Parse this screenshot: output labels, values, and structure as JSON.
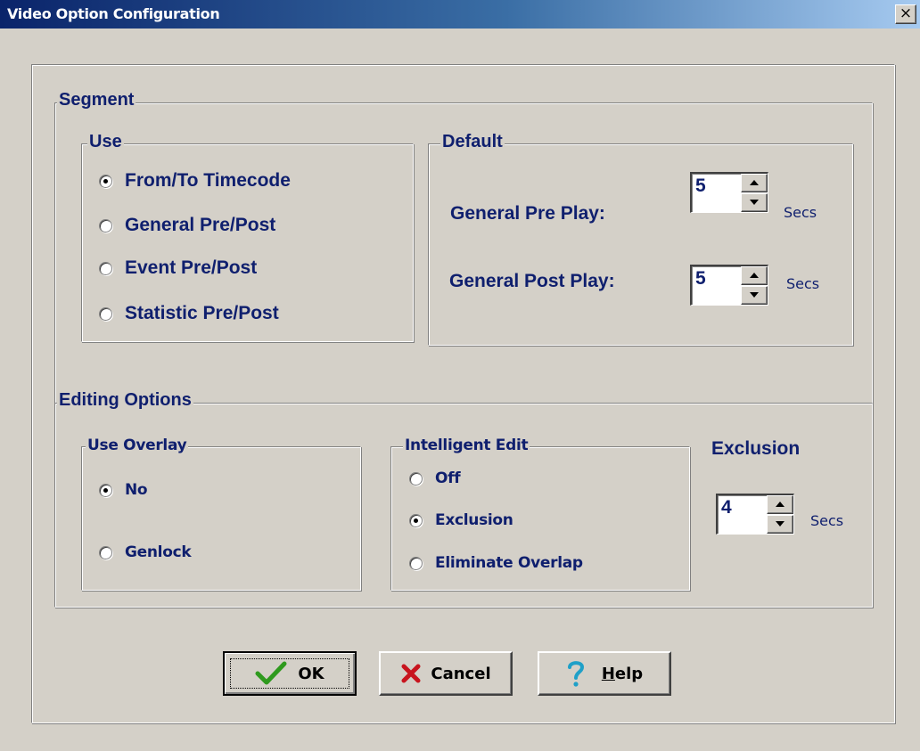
{
  "window": {
    "title": "Video Option Configuration",
    "close_glyph": "×"
  },
  "segment": {
    "legend": "Segment",
    "use": {
      "legend": "Use",
      "options": [
        {
          "label": "From/To Timecode",
          "checked": true
        },
        {
          "label": "General Pre/Post",
          "checked": false
        },
        {
          "label": "Event Pre/Post",
          "checked": false
        },
        {
          "label": "Statistic Pre/Post",
          "checked": false
        }
      ]
    },
    "default": {
      "legend": "Default",
      "pre_play_label": "General Pre Play:",
      "pre_play_value": "5",
      "pre_play_unit": "Secs",
      "post_play_label": "General Post Play:",
      "post_play_value": "5",
      "post_play_unit": "Secs"
    }
  },
  "editing": {
    "legend": "Editing Options",
    "use_overlay": {
      "legend": "Use Overlay",
      "options": [
        {
          "label": "No",
          "checked": true
        },
        {
          "label": "Genlock",
          "checked": false
        }
      ]
    },
    "intelligent_edit": {
      "legend": "Intelligent Edit",
      "options": [
        {
          "label": "Off",
          "checked": false
        },
        {
          "label": "Exclusion",
          "checked": true
        },
        {
          "label": "Eliminate Overlap",
          "checked": false
        }
      ]
    },
    "exclusion": {
      "label": "Exclusion",
      "value": "4",
      "unit": "Secs"
    }
  },
  "buttons": {
    "ok_label": "OK",
    "cancel_label": "Cancel",
    "help_label_underlined": "H",
    "help_label_rest": "elp"
  },
  "colors": {
    "label_text": "#0f1f6e",
    "dialog_bg": "#d4d0c8",
    "title_gradient_start": "#0a246a",
    "ok_check": "#2f9a1e",
    "cancel_x": "#c8141e",
    "help_mark": "#1fa0c8"
  }
}
